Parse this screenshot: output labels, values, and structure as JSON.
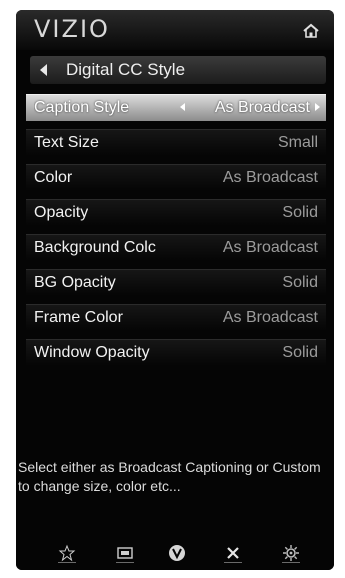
{
  "header": {
    "logo": "VIZIO",
    "home_icon": "home-icon"
  },
  "nav": {
    "back_title": "Digital CC Style",
    "back_icon": "left-arrow-icon"
  },
  "menu": {
    "items": [
      {
        "label": "Caption Style",
        "value": "As Broadcast",
        "selected": true
      },
      {
        "label": "Text Size",
        "value": "Small"
      },
      {
        "label": "Color",
        "value": "As Broadcast"
      },
      {
        "label": "Opacity",
        "value": "Solid"
      },
      {
        "label": "Background Colc",
        "value": "As Broadcast"
      },
      {
        "label": "BG Opacity",
        "value": "Solid"
      },
      {
        "label": "Frame Color",
        "value": "As Broadcast"
      },
      {
        "label": "Window Opacity",
        "value": "Solid"
      }
    ]
  },
  "help_text": "Select either as Broadcast Captioning or Custom to change size, color etc...",
  "bottom_icons": [
    "star-icon",
    "widget-icon",
    "v-logo-icon",
    "close-icon",
    "gear-icon"
  ],
  "colors": {
    "background": "#050505",
    "selected_row": "#c8c8c8",
    "label_text": "#f2f2f2",
    "value_text": "#9c9c9c"
  }
}
